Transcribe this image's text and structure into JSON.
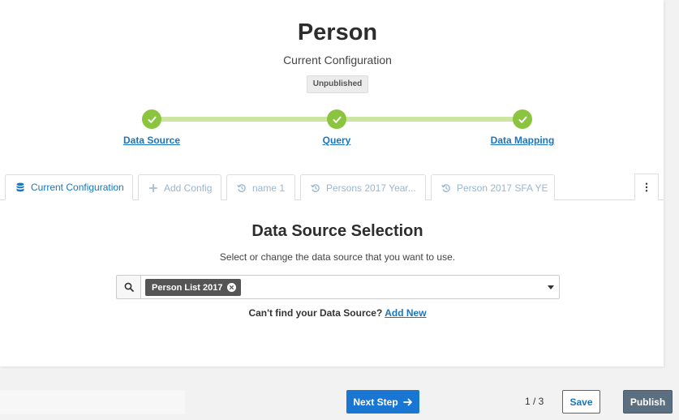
{
  "header": {
    "title": "Person",
    "subtitle": "Current Configuration",
    "status_badge": "Unpublished"
  },
  "stepper": {
    "steps": [
      {
        "label": "Data Source",
        "status": "complete"
      },
      {
        "label": "Query",
        "status": "complete"
      },
      {
        "label": "Data Mapping",
        "status": "complete"
      }
    ],
    "color_complete": "#8bc53f"
  },
  "tabs": [
    {
      "label": "Current Configuration",
      "icon": "database-icon",
      "active": true
    },
    {
      "label": "Add Config",
      "icon": "plus-icon",
      "active": false
    },
    {
      "label": "name 1",
      "icon": "history-icon",
      "active": false
    },
    {
      "label": "Persons 2017 Year...",
      "icon": "history-icon",
      "active": false
    },
    {
      "label": "Person 2017 SFA YE",
      "icon": "history-icon",
      "active": false
    }
  ],
  "main": {
    "section_title": "Data Source Selection",
    "section_description": "Select or change the data source that you want to use.",
    "selected_source": "Person List 2017",
    "help_text": "Can't find your Data Source?",
    "add_new_link": "Add New"
  },
  "footer": {
    "next_label": "Next Step",
    "page_indicator": "1 / 3",
    "save_label": "Save",
    "publish_label": "Publish"
  },
  "colors": {
    "accent": "#1976bd",
    "primary_button": "#1976d2",
    "publish_button": "#5c6f80"
  }
}
